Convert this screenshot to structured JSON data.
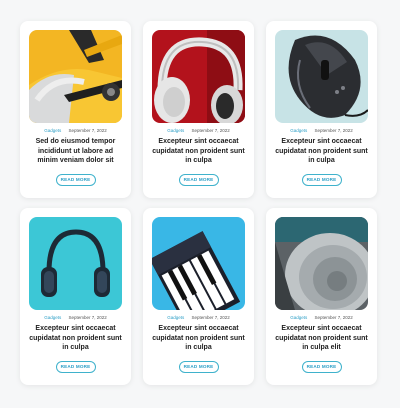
{
  "cards": [
    {
      "category": "Gadgets",
      "date": "September 7, 2022",
      "title": "Sed do eiusmod tempor incididunt ut labore ad minim veniam dolor sit",
      "button": "READ MORE",
      "image": "yellow-car-wheel"
    },
    {
      "category": "Gadgets",
      "date": "September 7, 2022",
      "title": "Excepteur sint occaecat cupidatat non proident sunt in culpa",
      "button": "READ MORE",
      "image": "white-headphones"
    },
    {
      "category": "Gadgets",
      "date": "September 7, 2022",
      "title": "Excepteur sint occaecat cupidatat non proident sunt in culpa",
      "button": "READ MORE",
      "image": "gaming-mouse"
    },
    {
      "category": "Gadgets",
      "date": "September 7, 2022",
      "title": "Excepteur sint occaecat cupidatat non proident sunt in culpa",
      "button": "READ MORE",
      "image": "blue-headphones"
    },
    {
      "category": "Gadgets",
      "date": "September 7, 2022",
      "title": "Excepteur sint occaecat cupidatat non proident sunt in culpa",
      "button": "READ MORE",
      "image": "piano-keys"
    },
    {
      "category": "Gadgets",
      "date": "September 7, 2022",
      "title": "Excepteur sint occaecat cupidatat non proident sunt in culpa elit",
      "button": "READ MORE",
      "image": "speaker-grille"
    }
  ],
  "colors": {
    "accent": "#2b9ec6",
    "title": "#1e1e1e",
    "background": "#f6f7f8"
  }
}
